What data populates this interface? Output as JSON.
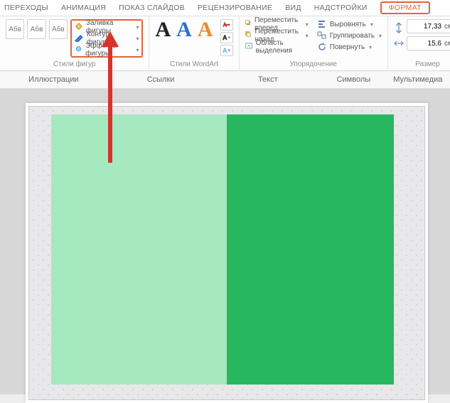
{
  "tabs": {
    "transitions": "ПЕРЕХОДЫ",
    "animation": "АНИМАЦИЯ",
    "slideshow": "ПОКАЗ СЛАЙДОВ",
    "review": "РЕЦЕНЗИРОВАНИЕ",
    "view": "ВИД",
    "addins": "НАДСТРОЙКИ",
    "format": "ФОРМАТ"
  },
  "ribbon": {
    "shape_styles_label": "Стили фигур",
    "wordart_label": "Стили WordArt",
    "arrange_label": "Упорядочение",
    "size_label": "Размер",
    "style_btn": "Абв",
    "fill": "Заливка фигуры",
    "outline": "Контур фигуры",
    "effects": "Эффекты фигуры",
    "text_fill": "A",
    "text_outline": "A",
    "text_effects": "A",
    "forward": "Переместить вперед",
    "backward": "Переместить назад",
    "selection": "Область выделения",
    "align": "Выровнять",
    "group": "Группировать",
    "rotate": "Повернуть",
    "height": "17,33",
    "width": "15,6",
    "unit": "см"
  },
  "bar2": {
    "illustrations": "Иллюстрации",
    "links": "Ссылки",
    "text": "Текст",
    "symbols": "Символы",
    "media": "Мультимедиа"
  },
  "canvas": {
    "left_color": "#a6e8bf",
    "right_color": "#27b85f"
  }
}
